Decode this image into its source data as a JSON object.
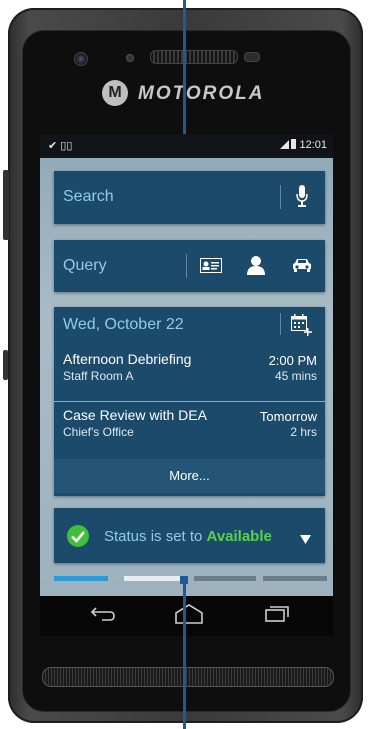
{
  "device": {
    "brand": "MOTOROLA",
    "logo_glyph": "M"
  },
  "statusbar": {
    "left_icons": "✔ ▯▯",
    "time": "12:01"
  },
  "search": {
    "label": "Search",
    "mic_icon": "microphone-icon"
  },
  "query": {
    "label": "Query",
    "icons": [
      "id-card-icon",
      "person-icon",
      "car-icon"
    ]
  },
  "calendar": {
    "date": "Wed, October 22",
    "events": [
      {
        "title": "Afternoon Debriefing",
        "location": "Staff Room A",
        "time": "2:00 PM",
        "duration": "45 mins"
      },
      {
        "title": "Case Review with DEA",
        "location": "Chief's Office",
        "time": "Tomorrow",
        "duration": "2 hrs"
      }
    ],
    "more_label": "More..."
  },
  "status": {
    "prefix": "Status is set to ",
    "value": "Available"
  },
  "colors": {
    "card_bg": "#1c4a6b",
    "accent_text": "#8fcbee",
    "available_green": "#58d24a",
    "pointer_blue": "#1c5a9a"
  }
}
